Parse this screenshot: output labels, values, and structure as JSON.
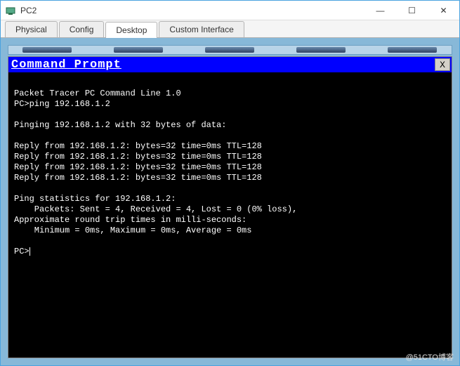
{
  "window": {
    "title": "PC2",
    "controls": {
      "min": "—",
      "max": "☐",
      "close": "✕"
    }
  },
  "tabs": [
    {
      "label": "Physical",
      "active": false
    },
    {
      "label": "Config",
      "active": false
    },
    {
      "label": "Desktop",
      "active": true
    },
    {
      "label": "Custom Interface",
      "active": false
    }
  ],
  "cmd": {
    "title": "Command Prompt",
    "close": "X",
    "lines": [
      "",
      "Packet Tracer PC Command Line 1.0",
      "PC>ping 192.168.1.2",
      "",
      "Pinging 192.168.1.2 with 32 bytes of data:",
      "",
      "Reply from 192.168.1.2: bytes=32 time=0ms TTL=128",
      "Reply from 192.168.1.2: bytes=32 time=0ms TTL=128",
      "Reply from 192.168.1.2: bytes=32 time=0ms TTL=128",
      "Reply from 192.168.1.2: bytes=32 time=0ms TTL=128",
      "",
      "Ping statistics for 192.168.1.2:",
      "    Packets: Sent = 4, Received = 4, Lost = 0 (0% loss),",
      "Approximate round trip times in milli-seconds:",
      "    Minimum = 0ms, Maximum = 0ms, Average = 0ms",
      "",
      "PC>"
    ]
  },
  "watermark": "@51CTO博客"
}
